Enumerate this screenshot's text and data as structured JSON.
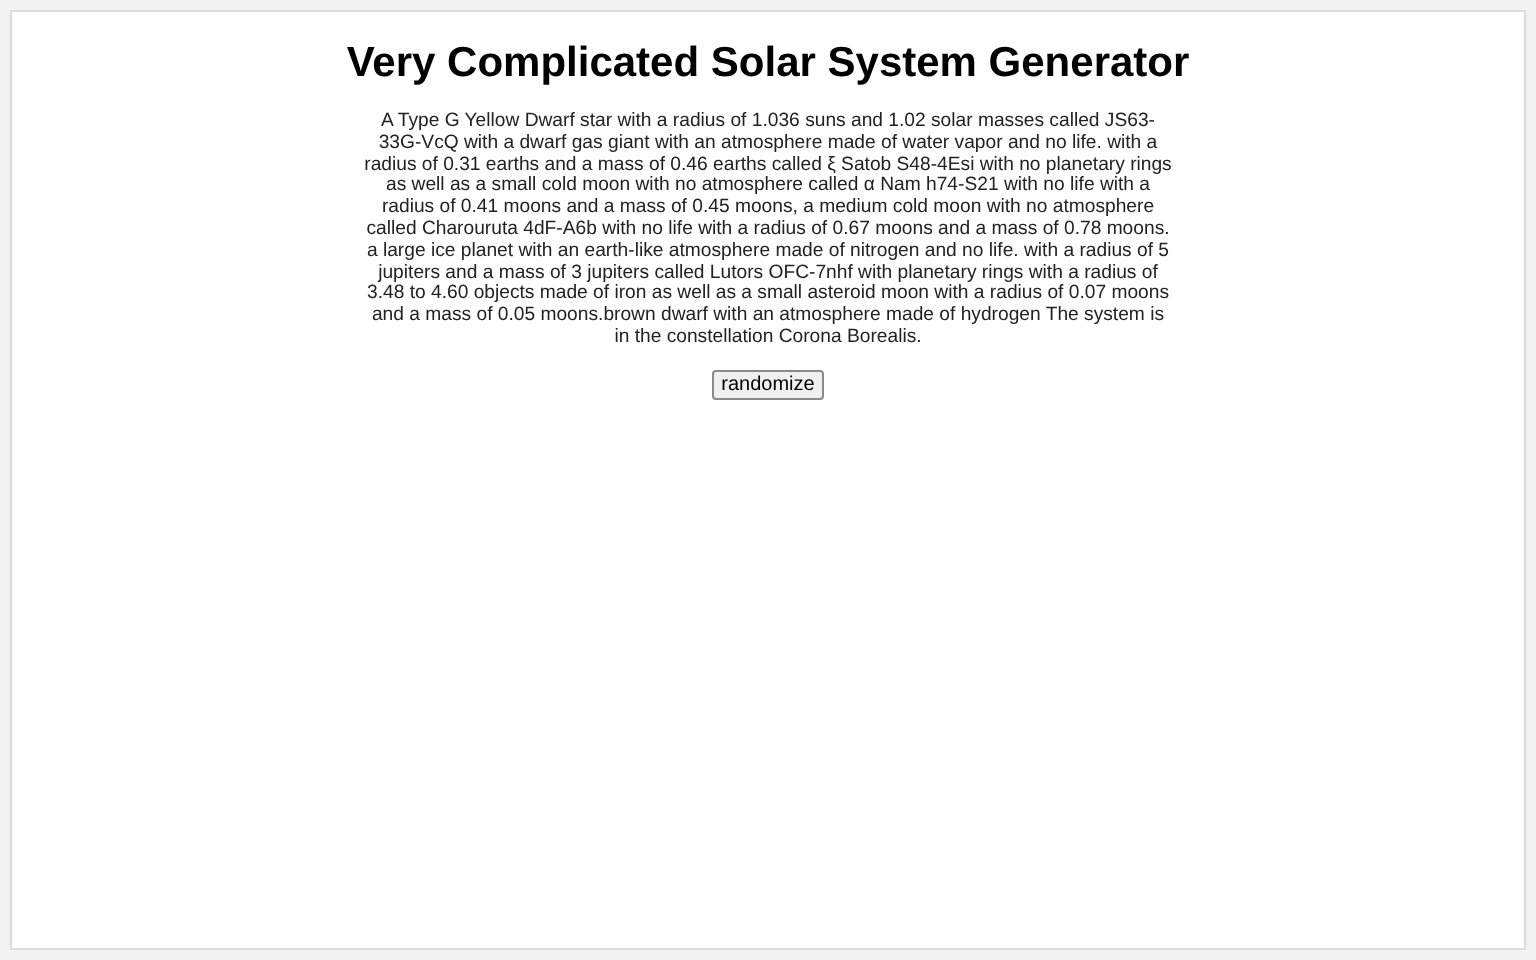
{
  "title": "Very Complicated Solar System Generator",
  "description": "A Type G Yellow Dwarf star with a radius of 1.036 suns and 1.02 solar masses called JS63-33G-VcQ with a dwarf gas giant with an atmosphere made of water vapor and no life. with a radius of 0.31 earths and a mass of 0.46 earths called ξ Satob S48-4Esi with no planetary rings as well as a small cold moon with no atmosphere called α Nam h74-S21 with no life with a radius of 0.41 moons and a mass of 0.45 moons, a medium cold moon with no atmosphere called Charouruta 4dF-A6b with no life with a radius of 0.67 moons and a mass of 0.78 moons. a large ice planet with an earth-like atmosphere made of nitrogen and no life. with a radius of 5 jupiters and a mass of 3 jupiters called Lutors OFC-7nhf with planetary rings with a radius of 3.48 to 4.60 objects made of iron as well as a small asteroid moon with a radius of 0.07 moons and a mass of 0.05 moons.brown dwarf with an atmosphere made of hydrogen The system is in the constellation Corona Borealis.",
  "button": "randomize"
}
